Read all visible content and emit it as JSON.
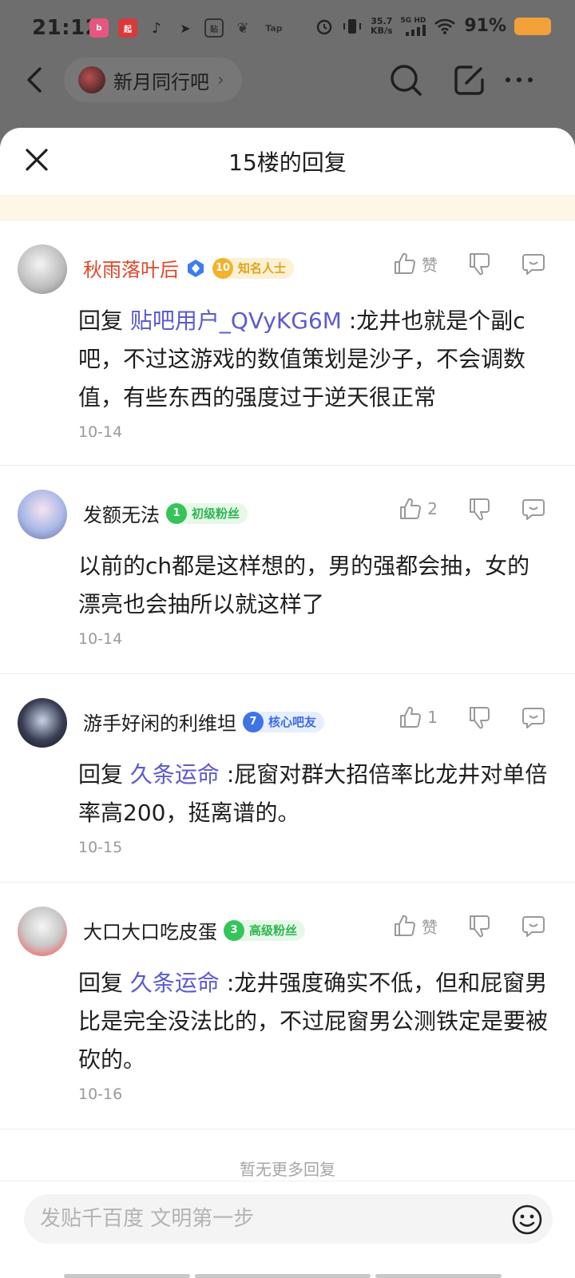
{
  "status_bar": {
    "time": "21:12",
    "notif_icons": [
      "bilibili-icon",
      "qidian-icon",
      "tiktok-icon",
      "bird-icon",
      "baidu-icon",
      "leaf-icon",
      "taptap-icon"
    ],
    "speed_top": "35.7",
    "speed_bottom": "KB/s",
    "network": "5G HD",
    "battery_pct": "91%"
  },
  "header": {
    "forum_name": "新月同行吧",
    "forum_chevron": "›"
  },
  "sheet": {
    "title": "15楼的回复"
  },
  "replies": [
    {
      "name": "秋雨落叶后",
      "badge_level": "10",
      "badge_text": "知名人士",
      "like_label": "赞",
      "reply_prefix": "回复 ",
      "mention": "贴吧用户_QVyKG6M",
      "text": " :龙井也就是个副c吧，不过这游戏的数值策划是沙子，不会调数值，有些东西的强度过于逆天很正常",
      "date": "10-14"
    },
    {
      "name": "发额无法",
      "badge_level": "1",
      "badge_text": "初级粉丝",
      "like_label": "2",
      "text": "以前的ch都是这样想的，男的强都会抽，女的漂亮也会抽所以就这样了",
      "date": "10-14"
    },
    {
      "name": "游手好闲的利维坦",
      "badge_level": "7",
      "badge_text": "核心吧友",
      "like_label": "1",
      "reply_prefix": "回复 ",
      "mention": "久条运命",
      "text": " :屁窗对群大招倍率比龙井对单倍率高200，挺离谱的。",
      "date": "10-15"
    },
    {
      "name": "大口大口吃皮蛋",
      "badge_level": "3",
      "badge_text": "高级粉丝",
      "like_label": "赞",
      "reply_prefix": "回复 ",
      "mention": "久条运命",
      "text": " :龙井强度确实不低，但和屁窗男比是完全没法比的，不过屁窗男公测铁定是要被砍的。",
      "date": "10-16"
    }
  ],
  "footer": {
    "no_more": "暂无更多回复",
    "input_placeholder": "发贴千百度 文明第一步"
  },
  "colors": {
    "accent_mention": "#5b5bd0",
    "vip_name": "#e0452a",
    "battery": "#f3a23a",
    "gold_badge": "#f3b22c",
    "green_badge": "#36c45a",
    "blue_badge": "#3f73e6"
  }
}
